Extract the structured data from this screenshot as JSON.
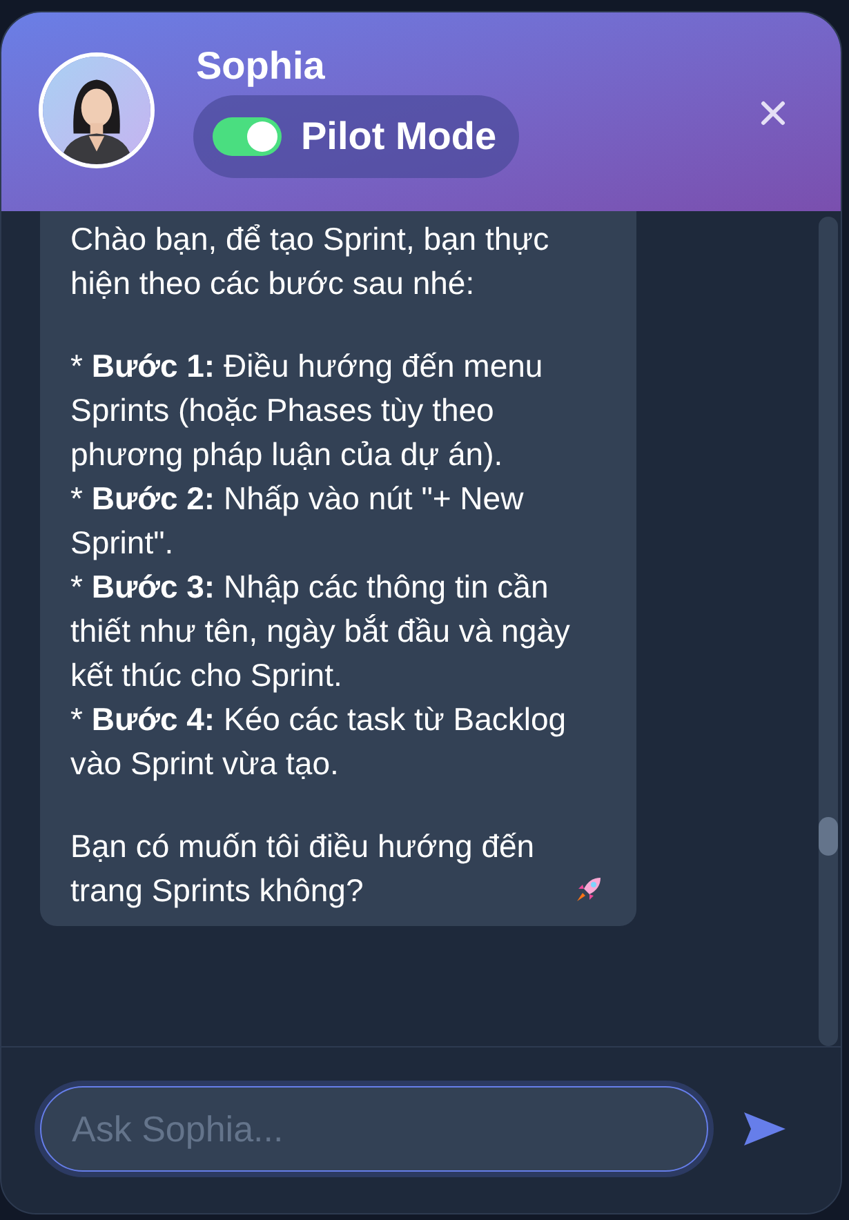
{
  "assistant": {
    "name": "Sophia"
  },
  "pilot_mode": {
    "label": "Pilot Mode",
    "on": true
  },
  "message": {
    "blocks": [
      [
        "Chào bạn, để tạo Sprint, bạn thực hiện theo các bước sau nhé:"
      ],
      [
        "* **Bước 1:** Điều hướng đến menu Sprints (hoặc Phases tùy theo phương pháp luận của dự án).",
        "* **Bước 2:** Nhấp vào nút \"+ New Sprint\".",
        "* **Bước 3:** Nhập các thông tin cần thiết như tên, ngày bắt đầu và ngày kết thúc cho Sprint.",
        "* **Bước 4:** Kéo các task từ Backlog vào Sprint vừa tạo."
      ],
      [
        "Bạn có muốn tôi điều hướng đến trang Sprints không?"
      ]
    ]
  },
  "input": {
    "placeholder": "Ask Sophia..."
  }
}
